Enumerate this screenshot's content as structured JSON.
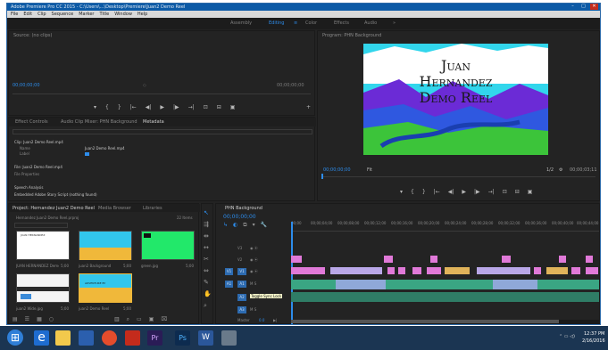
{
  "window": {
    "title": "Adobe Premiere Pro CC 2015 - C:\\Users\\...\\Desktop\\Premiere\\Juan2 Demo Reel",
    "min": "–",
    "max": "□",
    "close": "✕"
  },
  "menu": [
    "File",
    "Edit",
    "Clip",
    "Sequence",
    "Marker",
    "Title",
    "Window",
    "Help"
  ],
  "workspaces": [
    "Assembly",
    "Editing",
    "Color",
    "Effects",
    "Audio"
  ],
  "workspace_active": "Editing",
  "source_panel": {
    "title": "Source: (no clips)",
    "tc_left": "00;00;00;00",
    "tc_right": "00;00;00;00",
    "tabs": [
      "Effect Controls",
      "Audio Clip Mixer: PHN Background",
      "Metadata"
    ],
    "active_tab": "Metadata",
    "rows": [
      "Clip: Juan2 Demo Reel.mp4",
      "Name",
      "Label",
      "File: Juan2 Demo Reel.mp4",
      "File Properties",
      "Speech Analysis",
      "Embedded Adobe Story Script (nothing found)"
    ],
    "clip_name_value": "Juan2 Demo Reel.mp4"
  },
  "program_panel": {
    "title": "Program: PHN Background",
    "title_lines": [
      "Juan",
      "Hernandez",
      "Demo Reel"
    ],
    "tc_left": "00;00;00;00",
    "fit": "Fit",
    "scale": "1/2",
    "tc_right": "00;00;03;11"
  },
  "project_panel": {
    "tabs": [
      "Project: Hernandez Juan2 Demo Reel",
      "Media Browser",
      "Libraries"
    ],
    "path": "Hernandez Juan2 Demo Reel.prproj",
    "count": "22 Items",
    "items": [
      {
        "name": "JUAN HERNANDEZ Demo Reel",
        "dur": "5;00"
      },
      {
        "name": "juan2 Background",
        "dur": "5;00"
      },
      {
        "name": "green.jpg",
        "dur": "5;00"
      },
      {
        "name": "juan2 Wide.jpg",
        "dur": "5;00"
      },
      {
        "name": "juan2 Demo Reel",
        "dur": "5;00"
      }
    ],
    "thumb_title_1": "JUAN HERNANDEZ",
    "thumb_title_2": "ADVENTURE BY"
  },
  "timeline": {
    "tab": "PHN Background",
    "timecode": "00;00;00;00",
    "ruler": [
      "00;00",
      "00;00;04;00",
      "00;00;08;00",
      "00;00;12;00",
      "00;00;16;00",
      "00;00;20;00",
      "00;00;24;00",
      "00;00;28;00",
      "00;00;32;00",
      "00;00;36;00",
      "00;00;40;00",
      "00;00;44;00"
    ],
    "tracks": [
      "V3",
      "V2",
      "V1",
      "A1",
      "A2",
      "A3",
      "Master"
    ],
    "tooltip": "Toggle Sync Lock",
    "master_val": "0.0"
  },
  "taskbar": {
    "time": "12:37 PM",
    "date": "2/16/2016"
  },
  "colors": {
    "accent": "#2d8ceb",
    "video_clip": "#e079d8",
    "audio_clip": "#3aa583"
  }
}
